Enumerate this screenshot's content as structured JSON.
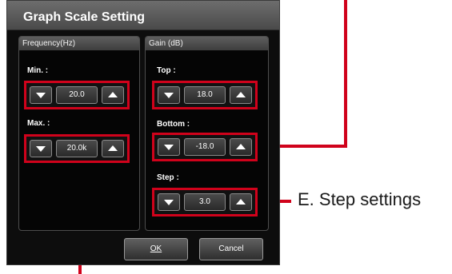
{
  "dialog": {
    "title": "Graph Scale Setting",
    "ok_label": "OK",
    "cancel_label": "Cancel"
  },
  "frequency_group": {
    "header": "Frequency(Hz)",
    "min": {
      "label": "Min. :",
      "value": "20.0"
    },
    "max": {
      "label": "Max. :",
      "value": "20.0k"
    }
  },
  "gain_group": {
    "header": "Gain (dB)",
    "top": {
      "label": "Top :",
      "value": "18.0"
    },
    "bottom": {
      "label": "Bottom :",
      "value": "-18.0"
    },
    "step": {
      "label": "Step :",
      "value": "3.0"
    }
  },
  "callouts": {
    "step_settings": "E. Step settings"
  },
  "colors": {
    "highlight": "#d0021b",
    "dialog_bg": "#0d0d0d"
  },
  "icons": {
    "decrement": "triangle-down-icon",
    "increment": "triangle-up-icon"
  }
}
